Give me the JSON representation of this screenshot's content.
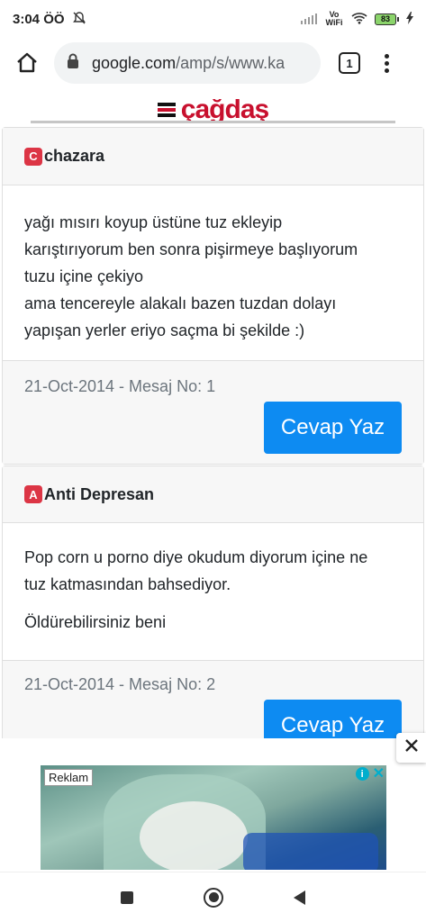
{
  "status_bar": {
    "time": "3:04 ÖÖ",
    "network_label": "Vo WiFi",
    "battery": "83"
  },
  "browser": {
    "url_domain": "google.com",
    "url_path": "/amp/s/www.ka",
    "tab_count": "1"
  },
  "site": {
    "logo_text": "çağdaş"
  },
  "posts": [
    {
      "badge": "C",
      "author": "chazara",
      "body_lines": [
        "yağı mısırı koyup üstüne tuz ekleyip",
        "karıştırıyorum ben sonra pişirmeye başlıyorum",
        "tuzu içine çekiyo",
        "ama tencereyle alakalı bazen tuzdan dolayı",
        "yapışan yerler eriyo saçma bi şekilde :)"
      ],
      "meta": "21-Oct-2014 - Mesaj No: 1",
      "reply_label": "Cevap Yaz"
    },
    {
      "badge": "A",
      "author": "Anti Depresan",
      "paragraph1_lines": [
        "Pop corn u porno diye okudum diyorum içine ne",
        "tuz katmasından bahsediyor."
      ],
      "paragraph2": "Öldürebilirsiniz beni",
      "meta": "21-Oct-2014 - Mesaj No: 2",
      "reply_label": "Cevap Yaz"
    }
  ],
  "ad": {
    "label": "Reklam",
    "info_glyph": "i",
    "close_glyph": "✕"
  },
  "colors": {
    "badge": "#dc3545",
    "button": "#0d8bf2",
    "meta": "#6c757d",
    "logo": "#c8102e"
  },
  "icons": [
    "bell-off-icon",
    "signal-icon",
    "wifi-icon",
    "battery-icon",
    "home-icon",
    "lock-icon",
    "tabs-icon",
    "menu-icon",
    "close-icon",
    "recents-icon",
    "back-icon"
  ]
}
